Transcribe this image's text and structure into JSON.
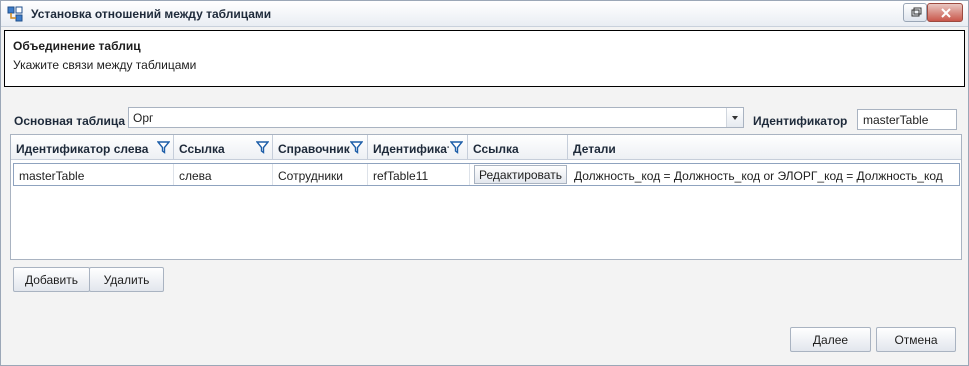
{
  "window": {
    "title": "Установка отношений между таблицами",
    "icon": "table-relations-icon"
  },
  "header": {
    "title": "Объединение таблиц",
    "subtitle": "Укажите связи между таблицами"
  },
  "form": {
    "main_table_label": "Основная таблица",
    "main_table_value": "Орг",
    "identifier_label": "Идентификатор",
    "identifier_value": "masterTable"
  },
  "grid": {
    "columns": [
      {
        "label": "Идентификатор слева",
        "filter": true
      },
      {
        "label": "Ссылка",
        "filter": true
      },
      {
        "label": "Справочник",
        "filter": true
      },
      {
        "label": "Идентификатор",
        "filter": true
      },
      {
        "label": "Ссылка",
        "filter": false
      },
      {
        "label": "Детали",
        "filter": false
      }
    ],
    "rows": [
      {
        "left_id": "masterTable",
        "link": "слева",
        "reference": "Сотрудники",
        "identifier": "refTable11",
        "edit_label": "Редактировать",
        "details": "Должность_код = Должность_код or ЭЛОРГ_код = Должность_код"
      }
    ]
  },
  "buttons": {
    "add": "Добавить",
    "delete": "Удалить",
    "next": "Далее",
    "cancel": "Отмена"
  }
}
